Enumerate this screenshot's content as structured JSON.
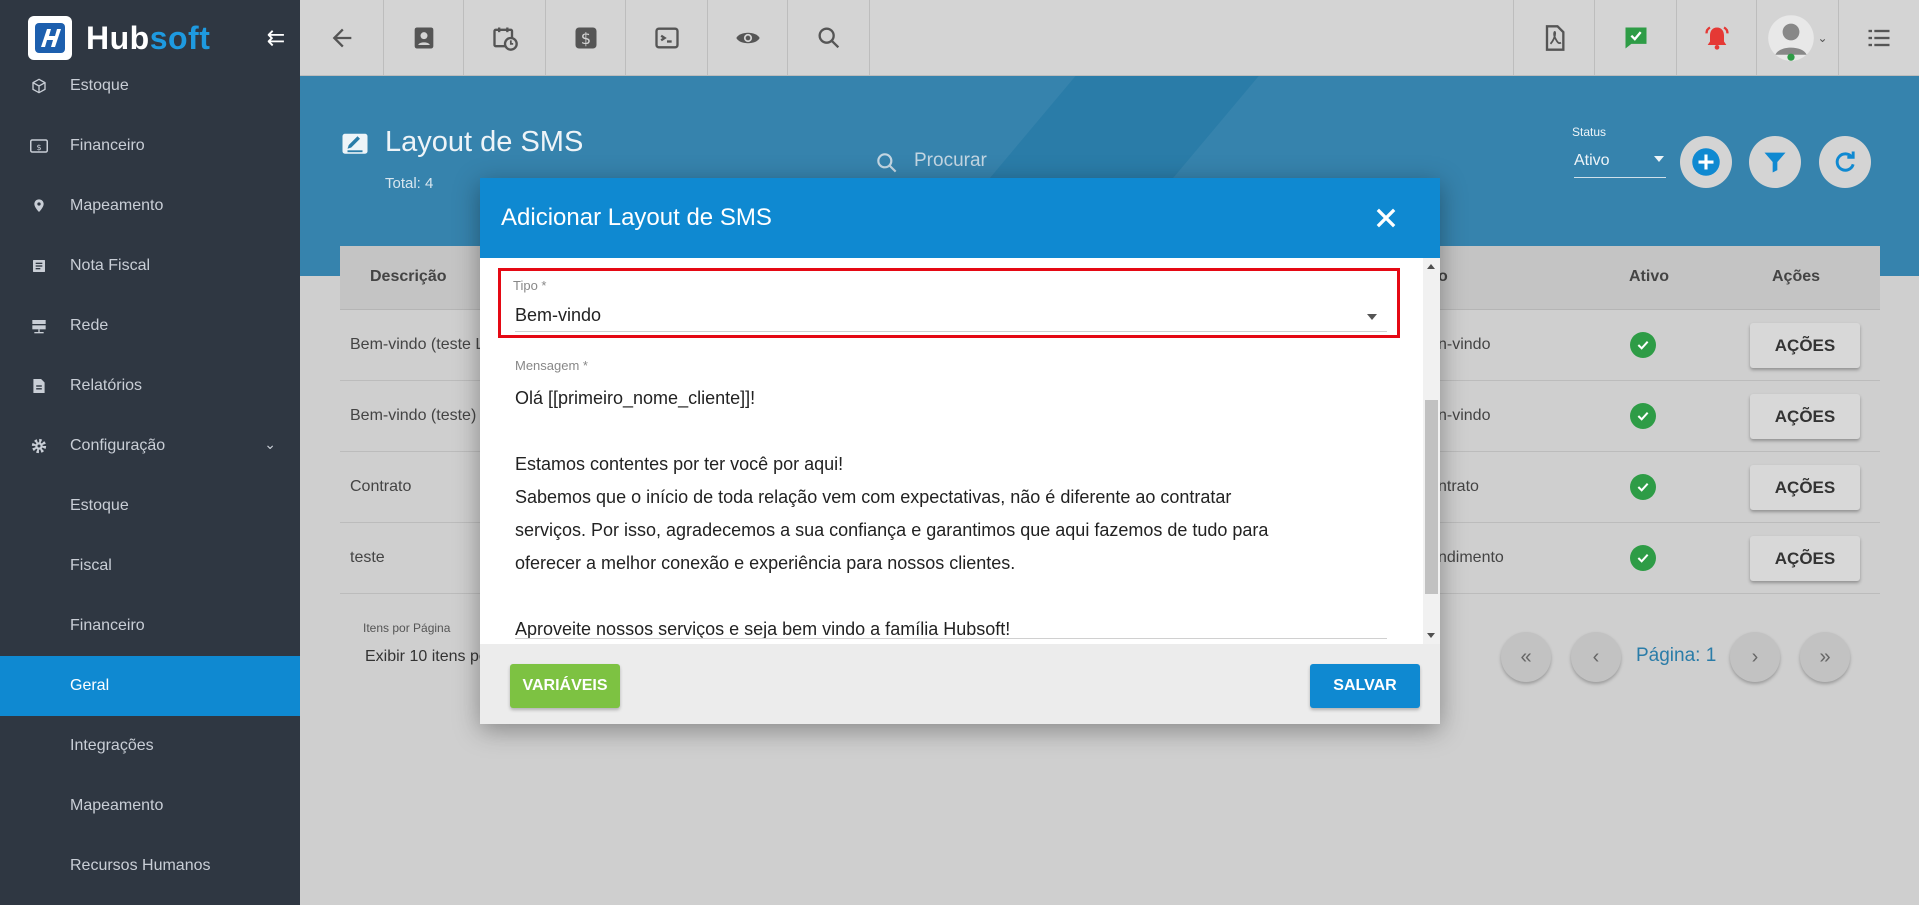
{
  "app": {
    "logo_hub": "Hub",
    "logo_soft": "soft"
  },
  "toolbar": {
    "buttons": [
      "back-icon",
      "contact-card-icon",
      "calendar-clock-icon",
      "dollar-icon",
      "terminal-icon",
      "eye-icon",
      "search-icon",
      "pdf-icon",
      "task-check-icon",
      "alarm-bell-icon",
      "user-avatar-icon",
      "menu-list-icon"
    ]
  },
  "sidebar": {
    "items": [
      {
        "label": "Estoque",
        "icon": "box-icon"
      },
      {
        "label": "Financeiro",
        "icon": "money-icon"
      },
      {
        "label": "Mapeamento",
        "icon": "map-pin-icon"
      },
      {
        "label": "Nota Fiscal",
        "icon": "document-list-icon"
      },
      {
        "label": "Rede",
        "icon": "server-icon"
      },
      {
        "label": "Relatórios",
        "icon": "report-icon"
      },
      {
        "label": "Configuração",
        "icon": "gear-icon"
      }
    ],
    "sub_items": [
      "Estoque",
      "Fiscal",
      "Financeiro",
      "Geral",
      "Integrações",
      "Mapeamento",
      "Recursos Humanos"
    ],
    "active_sub": "Geral"
  },
  "page": {
    "title": "Layout de SMS",
    "total": "Total: 4",
    "search_placeholder": "Procurar",
    "status_label": "Status",
    "status_value": "Ativo"
  },
  "table": {
    "headers": {
      "descricao": "Descrição",
      "tipo": "o",
      "ativo": "Ativo",
      "acoes": "Ações"
    },
    "rows": [
      {
        "descricao": "Bem-vindo (teste L",
        "tipo": "n-vindo",
        "action": "AÇÕES"
      },
      {
        "descricao": "Bem-vindo (teste)",
        "tipo": "n-vindo",
        "action": "AÇÕES"
      },
      {
        "descricao": "Contrato",
        "tipo": "ntrato",
        "action": "AÇÕES"
      },
      {
        "descricao": "teste",
        "tipo": "ndimento",
        "action": "AÇÕES"
      }
    ],
    "items_per_page_label": "Itens por Página",
    "items_per_page_value": "Exibir 10 itens pe",
    "page_label": "Página: 1"
  },
  "modal": {
    "title": "Adicionar Layout de SMS",
    "tipo_label": "Tipo *",
    "tipo_value": "Bem-vindo",
    "mensagem_label": "Mensagem *",
    "mensagem_text": "Olá [[primeiro_nome_cliente]]!\n\nEstamos contentes por ter você por aqui!\nSabemos que o início de toda relação vem com expectativas, não é diferente ao contratar\nserviços. Por isso, agradecemos a sua confiança e garantimos que aqui fazemos de tudo para\noferecer a melhor conexão e experiência para nossos clientes.\n\nAproveite nossos serviços e seja bem vindo a família Hubsoft!",
    "btn_variaveis": "VARIÁVEIS",
    "btn_salvar": "SALVAR"
  },
  "colors": {
    "accent": "#0f89d1",
    "sidebar_bg": "#2f3742",
    "success": "#2e9c46",
    "variaveis": "#7dc242",
    "highlight_border": "#e50914"
  }
}
